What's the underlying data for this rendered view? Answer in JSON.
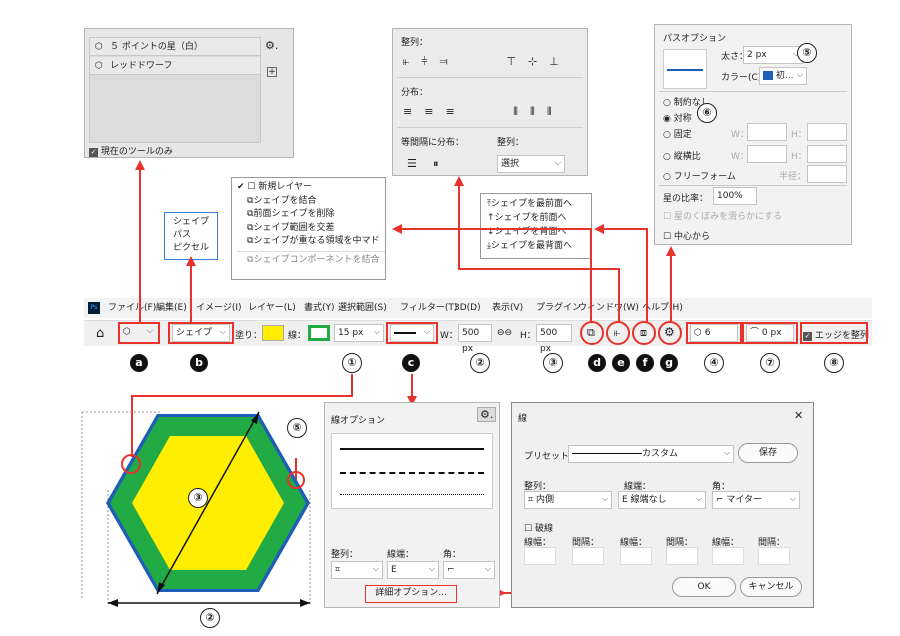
{
  "preset_panel": {
    "items": [
      "５ ポイントの星（白）",
      "レッドドワーフ"
    ],
    "checkbox": "現在のツールのみ"
  },
  "align_panel": {
    "align_title": "整列：",
    "distribute_title": "分布：",
    "equal_title": "等間隔に分布：",
    "align2_title": "整列：",
    "select_value": "選択"
  },
  "path_options": {
    "title": "パスオプション",
    "width_label": "太さ：",
    "width_value": "2 px",
    "color_label": "カラー(C)：",
    "color_value": "初...",
    "radios": [
      "制約なし",
      "対称",
      "固定",
      "縦横比",
      "フリーフォーム"
    ],
    "w_label": "W：",
    "h_label": "H：",
    "radius_label": "半径：",
    "ratio_label": "星の比率：",
    "ratio_value": "100%",
    "indent_label": "星のくぼみを滑らかにする",
    "center_label": "中心から"
  },
  "mode_list": [
    "シェイプ",
    "パス",
    "ピクセル"
  ],
  "combine_menu": [
    "新規レイヤー",
    "シェイプを結合",
    "前面シェイプを削除",
    "シェイプ範囲を交差",
    "シェイプが重なる領域を中マド",
    "シェイプコンポーネントを結合"
  ],
  "arrange_menu": [
    "シェイプを最前面へ",
    "シェイプを前面へ",
    "シェイプを背面へ",
    "シェイプを最背面へ"
  ],
  "menubar": [
    "ファイル(F)",
    "編集(E)",
    "イメージ(I)",
    "レイヤー(L)",
    "書式(Y)",
    "選択範囲(S)",
    "フィルター(T)",
    "3D(D)",
    "表示(V)",
    "プラグイン",
    "ウィンドウ(W)",
    "ヘルプ(H)"
  ],
  "toolbar": {
    "mode": "シェイプ",
    "fill_label": "塗り：",
    "stroke_label": "線：",
    "stroke_width": "15 px",
    "w_label": "W：",
    "w_value": "500 px",
    "link": "⊖⊖",
    "h_label": "H：",
    "h_value": "500 px",
    "sides": "6",
    "radius": "0 px",
    "align_edges": "エッジを整列"
  },
  "callouts": {
    "a": "a",
    "b": "b",
    "c": "c",
    "d": "d",
    "e": "e",
    "f": "f",
    "g": "g",
    "n1": "①",
    "n2": "②",
    "n3": "③",
    "n4": "④",
    "n5": "⑤",
    "n6": "⑥",
    "n7": "⑦",
    "n8": "⑧"
  },
  "stroke_options": {
    "title": "線オプション",
    "align_label": "整列：",
    "cap_label": "線端：",
    "corner_label": "角：",
    "more": "詳細オプション..."
  },
  "stroke_dialog": {
    "title": "線",
    "close": "✕",
    "preset_label": "プリセット：",
    "preset_value": "カスタム",
    "save": "保存",
    "align_label": "整列：",
    "align_value": "内側",
    "cap_label": "線端：",
    "cap_value": "線端なし",
    "corner_label": "角：",
    "corner_value": "マイター",
    "dash_label": "破線",
    "dash_label2": "線幅：",
    "gap_label": "間隔：",
    "ok": "OK",
    "cancel": "キャンセル"
  },
  "colors": {
    "fill": "#ffee00",
    "stroke": "#22aa44",
    "accent": "#e8322c",
    "blue": "#1e5eb8"
  }
}
